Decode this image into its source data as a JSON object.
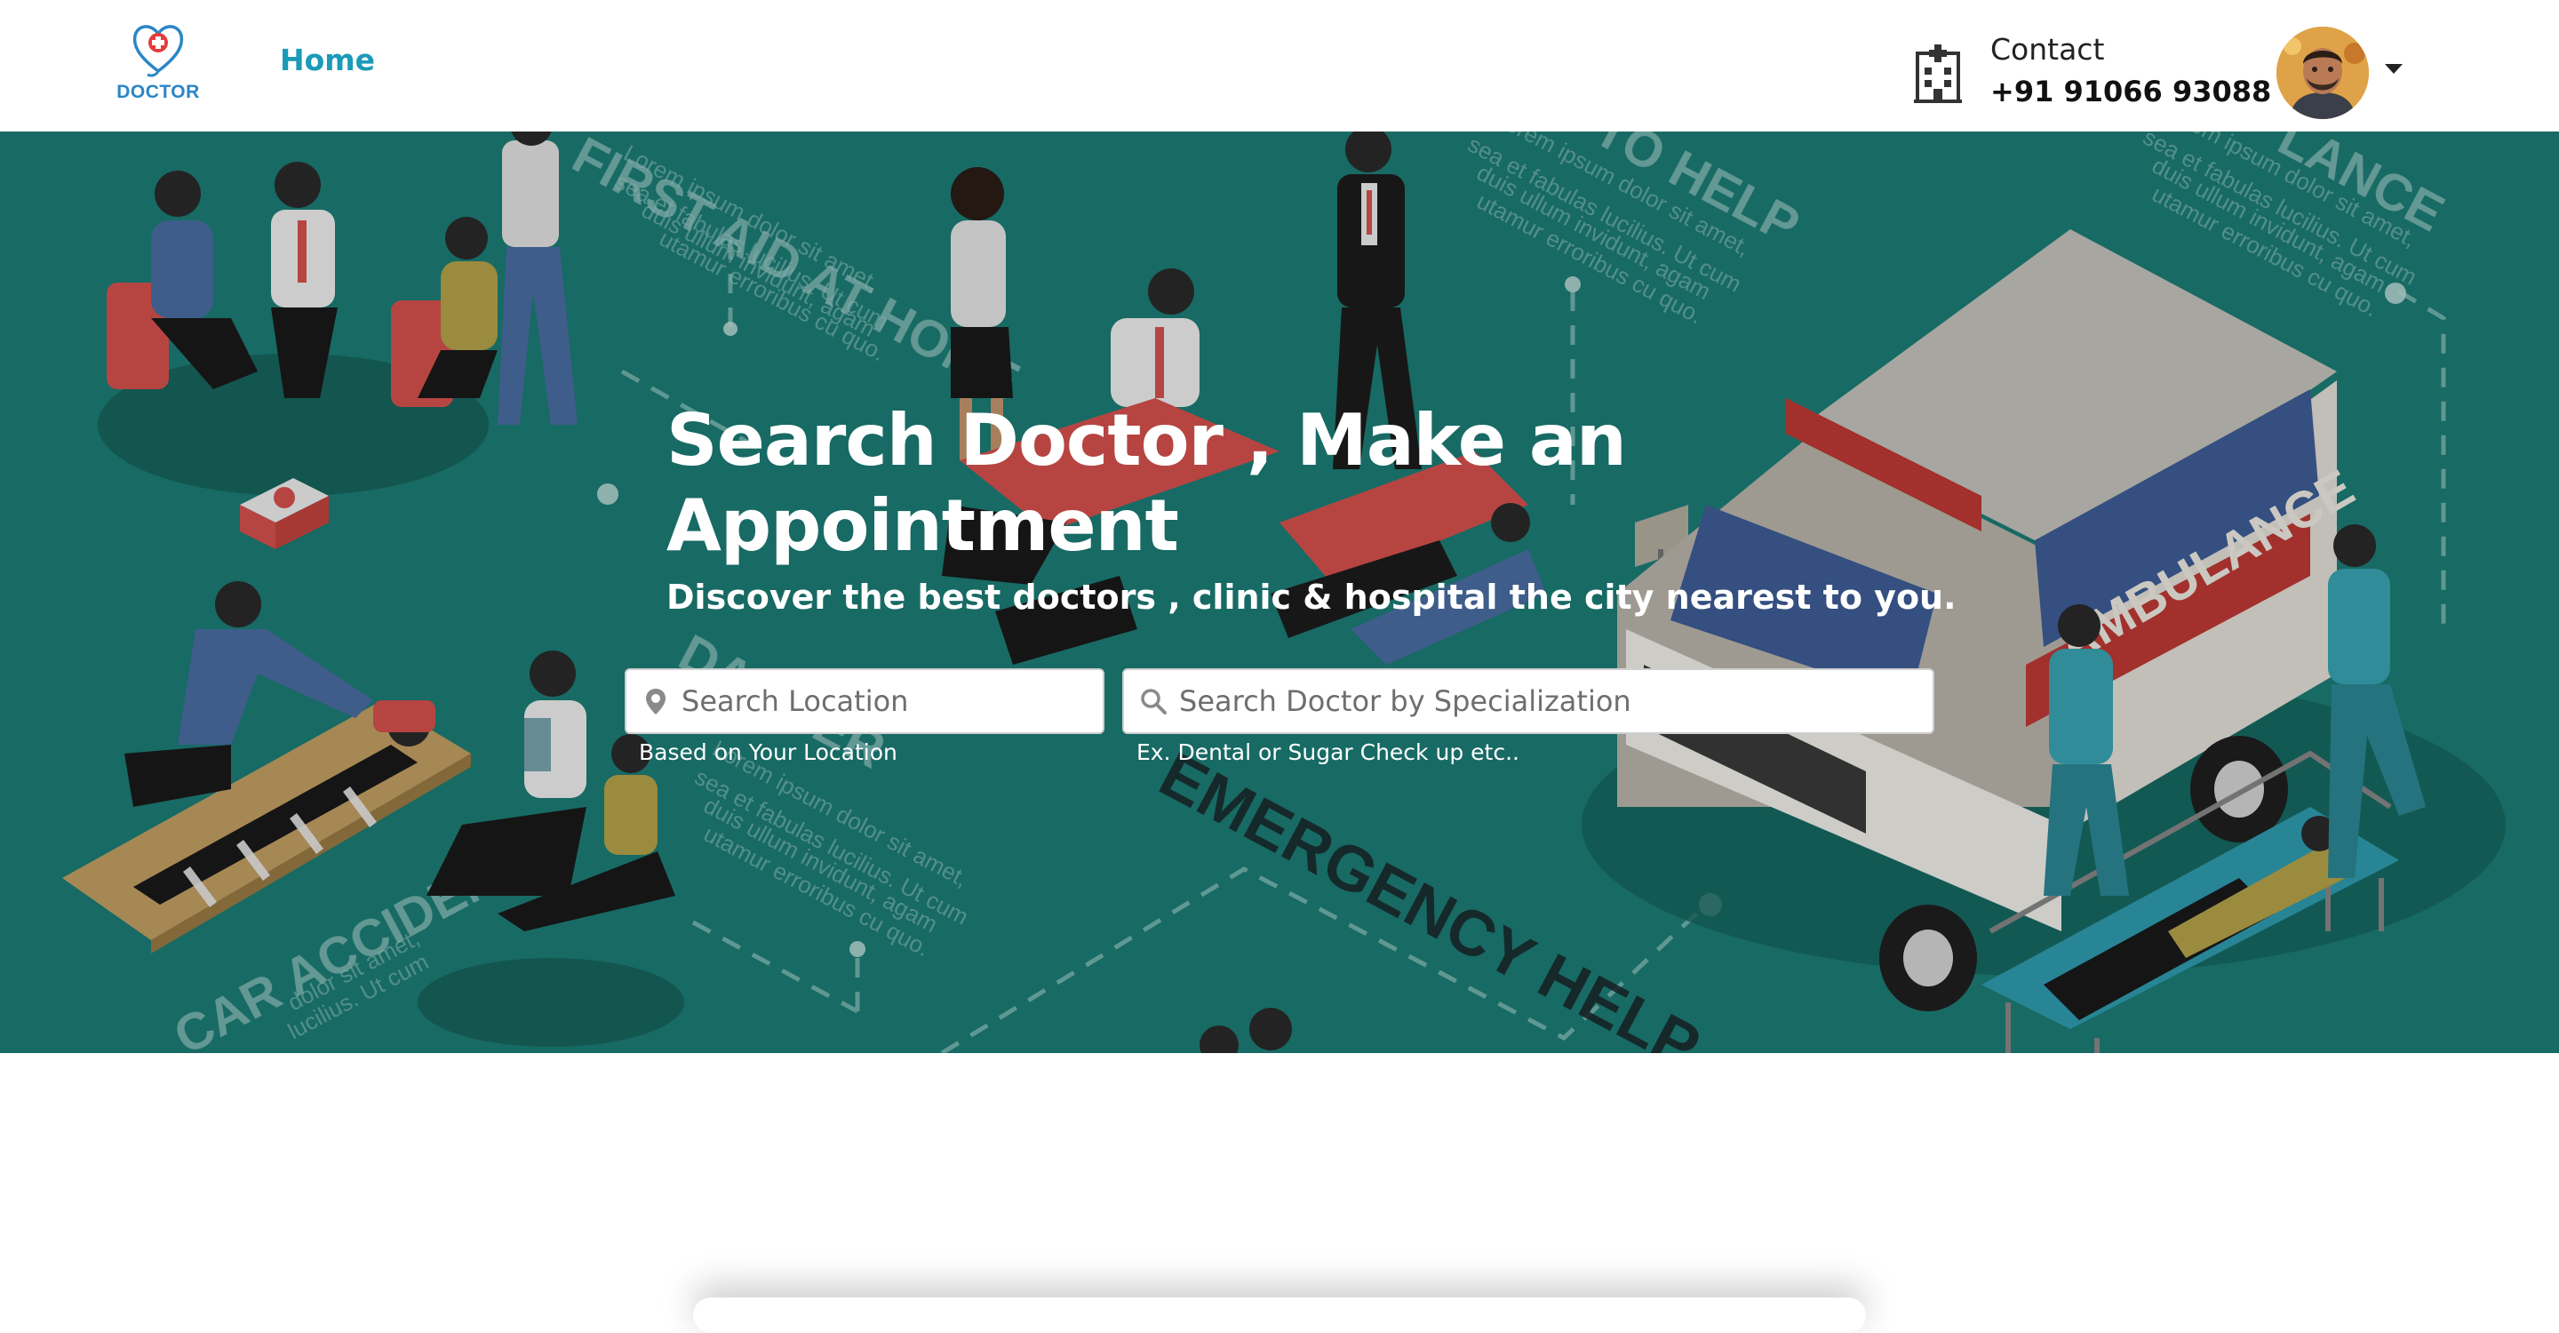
{
  "header": {
    "logo_text": "DOCTOR",
    "nav": {
      "home_label": "Home"
    },
    "contact": {
      "label": "Contact",
      "phone": "+91 91066 93088"
    }
  },
  "hero": {
    "title": "Search Doctor , Make an Appointment",
    "subtitle": "Discover the best doctors , clinic & hospital the city nearest to you.",
    "search_location": {
      "placeholder": "Search Location",
      "hint": "Based on Your Location"
    },
    "search_specialization": {
      "placeholder": "Search Doctor by Specialization",
      "hint": "Ex. Dental or Sugar Check up etc.."
    },
    "background_labels": [
      "FIRST AID AT HOME",
      "EMERGENCY HELP",
      "CAR ACCIDENT",
      "AMBULANCE"
    ]
  },
  "colors": {
    "hero_background": "#1d7f78",
    "nav_accent": "#1a9bb8",
    "logo_blue": "#2a86c7",
    "logo_red": "#e53b3b"
  },
  "icons": {
    "logo": "heart-stethoscope-icon",
    "contact": "hospital-building-icon",
    "location": "map-pin-icon",
    "search": "search-icon",
    "account_menu": "chevron-down-icon"
  }
}
